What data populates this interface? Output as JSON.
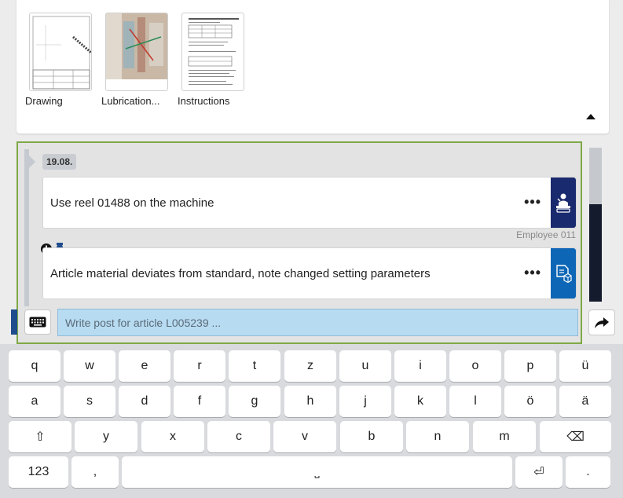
{
  "documents": [
    {
      "label": "Drawing",
      "icon": "drawing-thumbnail"
    },
    {
      "label": "Lubrication...",
      "icon": "photo-thumbnail"
    },
    {
      "label": "Instructions",
      "icon": "instructions-thumbnail"
    }
  ],
  "feed": {
    "date": "19.08.",
    "posts": [
      {
        "text": "Use reel 01488 on the machine",
        "author": "Employee 011",
        "icon": "operator-icon",
        "accent": "#1a2a6e"
      },
      {
        "text": "Article material deviates from standard, note changed setting parameters",
        "icon": "document-box-icon",
        "accent": "#0e66b6"
      }
    ]
  },
  "compose": {
    "placeholder": "Write post for article L005239 ..."
  },
  "keyboard": {
    "row1": [
      "q",
      "w",
      "e",
      "r",
      "t",
      "z",
      "u",
      "i",
      "o",
      "p",
      "ü"
    ],
    "row2": [
      "a",
      "s",
      "d",
      "f",
      "g",
      "h",
      "j",
      "k",
      "l",
      "ö",
      "ä"
    ],
    "row3": [
      "⇧",
      "y",
      "x",
      "c",
      "v",
      "b",
      "n",
      "m",
      "⌫"
    ],
    "row4": [
      "123",
      ",",
      "˽",
      "⏎",
      "."
    ]
  }
}
